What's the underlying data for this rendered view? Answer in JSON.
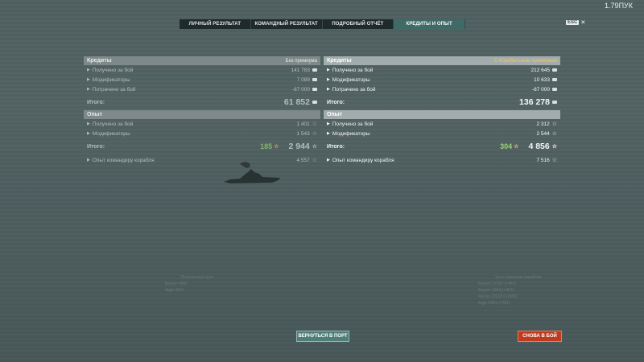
{
  "fps": "1.79ПУК",
  "esc": {
    "key": "ESC"
  },
  "tabs": [
    "ЛИЧНЫЙ РЕЗУЛЬТАТ",
    "КОМАНДНЫЙ РЕЗУЛЬТАТ",
    "ПОДРОБНЫЙ ОТЧЁТ",
    "КРЕДИТЫ И ОПЫТ"
  ],
  "left": {
    "credits_title": "Кредиты",
    "credits_sub": "Без премиума",
    "rows": [
      {
        "label": "Получено за бой",
        "value": "141 783"
      },
      {
        "label": "Модификаторы",
        "value": "7 089"
      },
      {
        "label": "Потрачено за бой",
        "value": "-87 000"
      }
    ],
    "total_label": "Итого:",
    "total": "61 852",
    "exp_title": "Опыт",
    "exp_rows": [
      {
        "label": "Получено за бой",
        "value": "1 401"
      },
      {
        "label": "Модификаторы",
        "value": "1 543"
      }
    ],
    "exp_total_label": "Итого:",
    "exp_free": "185",
    "exp_total": "2 944",
    "commander_label": "Опыт командиру корабля",
    "commander": "4 557"
  },
  "right": {
    "credits_title": "Кредиты",
    "credits_sub": "С Корабельным премиумом",
    "rows": [
      {
        "label": "Получено за бой",
        "value": "212 645"
      },
      {
        "label": "Модификаторы",
        "value": "10 633"
      },
      {
        "label": "Потрачено за бой",
        "value": "-87 000"
      }
    ],
    "total_label": "Итого:",
    "total": "136 278",
    "exp_title": "Опыт",
    "exp_rows": [
      {
        "label": "Получено за бой",
        "value": "2 312"
      },
      {
        "label": "Модификаторы",
        "value": "2 544"
      }
    ],
    "exp_total_label": "Итого:",
    "exp_free": "304",
    "exp_total": "4 856",
    "commander_label": "Опыт командиру корабля",
    "commander": "7 516"
  },
  "faint_left": {
    "title": "Полученные урон",
    "lines": [
      "Bayern  4687",
      "Aigle  2816"
    ]
  },
  "faint_right": {
    "title": "Урон союзным кораблям",
    "lines": [
      "Bayern  17222  (+457)",
      "Bayern  4264  (+467)",
      "Myoko  22018  (+1606)",
      "Aigle  8391  (+781)"
    ]
  },
  "buttons": {
    "port": "ВЕРНУТЬСЯ В ПОРТ",
    "battle": "СНОВА В БОЙ"
  }
}
